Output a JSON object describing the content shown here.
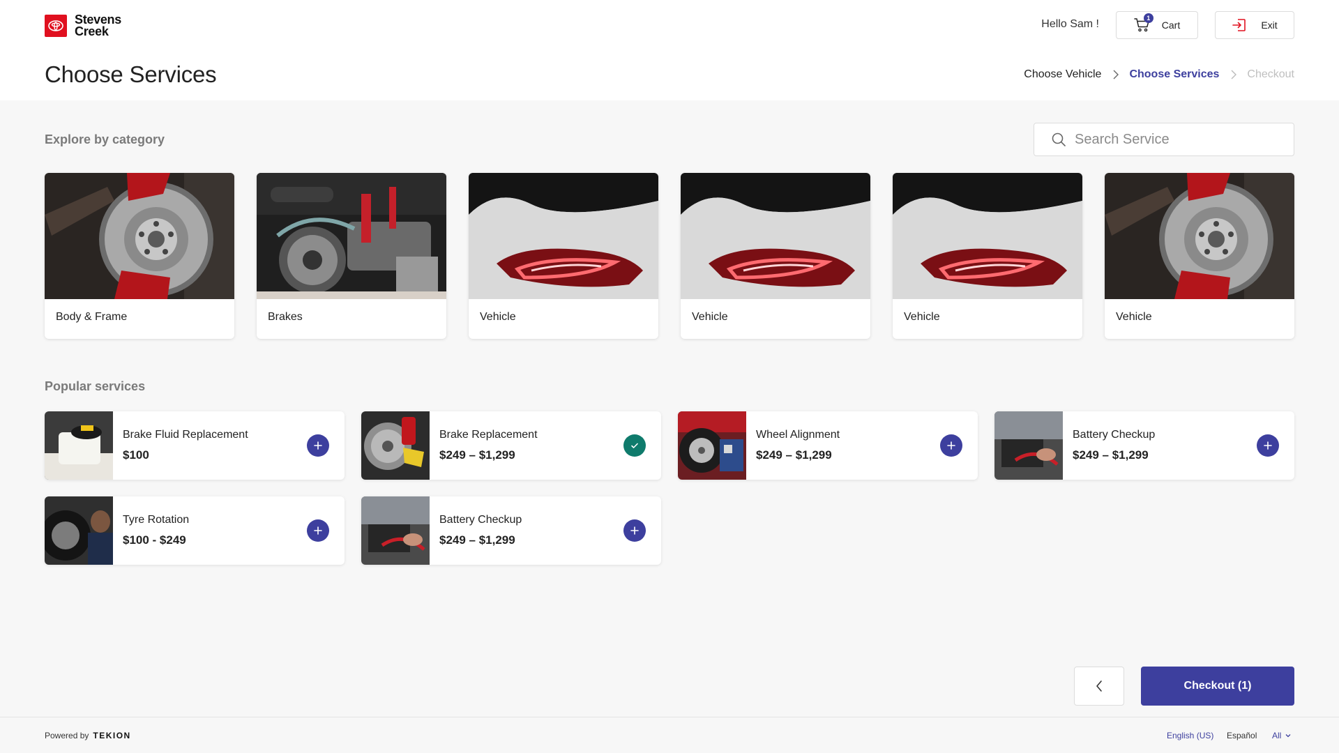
{
  "brand": {
    "name_line1": "Stevens",
    "name_line2": "Creek",
    "color": "#e0101f"
  },
  "header": {
    "greeting": "Hello Sam !",
    "cart": {
      "label": "Cart",
      "count": "1",
      "icon": "cart-icon"
    },
    "exit": {
      "label": "Exit",
      "icon": "exit-icon"
    }
  },
  "page_title": "Choose Services",
  "breadcrumb": {
    "step1": "Choose Vehicle",
    "step2": "Choose Services",
    "step3": "Checkout",
    "active_step": 2
  },
  "categories": {
    "title": "Explore by category",
    "items": [
      {
        "label": "Body & Frame",
        "image": "brake-disc-photo"
      },
      {
        "label": "Brakes",
        "image": "engine-belt-photo"
      },
      {
        "label": "Vehicle",
        "image": "car-taillight-photo"
      },
      {
        "label": "Vehicle",
        "image": "car-taillight-photo"
      },
      {
        "label": "Vehicle",
        "image": "car-taillight-photo"
      },
      {
        "label": "Vehicle",
        "image": "brake-disc-photo"
      }
    ]
  },
  "search": {
    "placeholder": "Search Service",
    "value": ""
  },
  "popular": {
    "title": "Popular services",
    "items": [
      {
        "name": "Brake Fluid Replacement",
        "price": "$100",
        "added": false
      },
      {
        "name": "Brake Replacement",
        "price": "$249 – $1,299",
        "added": true
      },
      {
        "name": "Wheel Alignment",
        "price": "$249 – $1,299",
        "added": false
      },
      {
        "name": "Battery Checkup",
        "price": "$249 – $1,299",
        "added": false
      },
      {
        "name": "Tyre Rotation",
        "price": "$100 - $249",
        "added": false
      },
      {
        "name": "Battery Checkup",
        "price": "$249 – $1,299",
        "added": false
      }
    ]
  },
  "actions": {
    "back_icon": "chevron-left-icon",
    "checkout_label": "Checkout (1)"
  },
  "footer": {
    "powered_by": "Powered by",
    "powered_brand": "TEKION",
    "lang_english": "English (US)",
    "lang_spanish": "Español",
    "lang_all": "All"
  },
  "colors": {
    "accent": "#3d3f9e",
    "success": "#0f7b6c",
    "background": "#f7f7f7"
  }
}
